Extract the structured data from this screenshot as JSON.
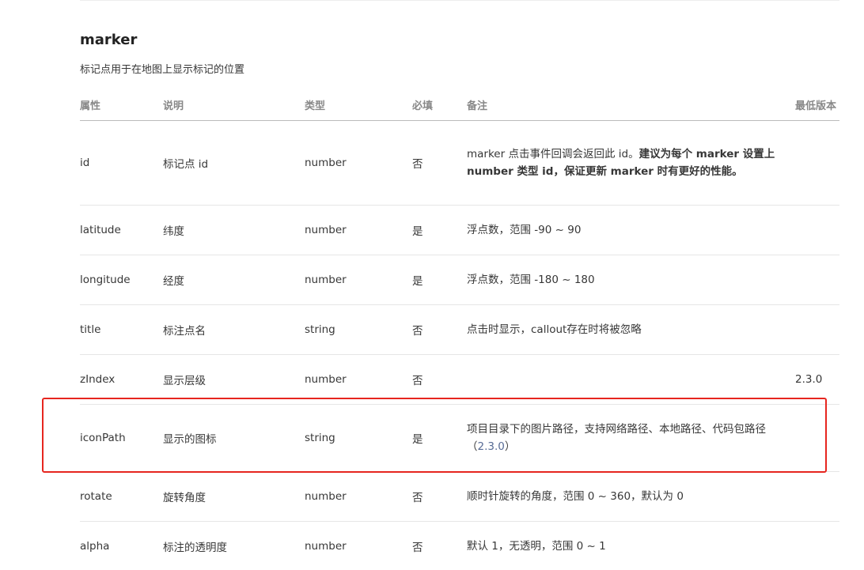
{
  "section": {
    "title": "marker",
    "description": "标记点用于在地图上显示标记的位置"
  },
  "table": {
    "headers": [
      "属性",
      "说明",
      "类型",
      "必填",
      "备注",
      "最低版本"
    ],
    "rows": [
      {
        "attr": "id",
        "desc": "标记点 id",
        "type": "number",
        "required": "否",
        "note_plain": "marker 点击事件回调会返回此 id。",
        "note_bold": "建议为每个 marker 设置上 number 类型 id，保证更新 marker 时有更好的性能。",
        "version": ""
      },
      {
        "attr": "latitude",
        "desc": "纬度",
        "type": "number",
        "required": "是",
        "note_plain": "浮点数，范围 -90 ~ 90",
        "version": ""
      },
      {
        "attr": "longitude",
        "desc": "经度",
        "type": "number",
        "required": "是",
        "note_plain": "浮点数，范围 -180 ~ 180",
        "version": ""
      },
      {
        "attr": "title",
        "desc": "标注点名",
        "type": "string",
        "required": "否",
        "note_plain": "点击时显示，callout存在时将被忽略",
        "version": ""
      },
      {
        "attr": "zIndex",
        "desc": "显示层级",
        "type": "number",
        "required": "否",
        "note_plain": "",
        "version": "2.3.0"
      },
      {
        "attr": "iconPath",
        "desc": "显示的图标",
        "type": "string",
        "required": "是",
        "note_plain": "项目目录下的图片路径，支持网络路径、本地路径、代码包路径（",
        "note_link": "2.3.0",
        "note_suffix": "）",
        "version": ""
      },
      {
        "attr": "rotate",
        "desc": "旋转角度",
        "type": "number",
        "required": "否",
        "note_plain": "顺时针旋转的角度，范围 0 ~ 360，默认为 0",
        "version": ""
      },
      {
        "attr": "alpha",
        "desc": "标注的透明度",
        "type": "number",
        "required": "否",
        "note_plain": "默认 1，无透明，范围 0 ~ 1",
        "version": ""
      }
    ]
  },
  "colors": {
    "highlight_border": "#e6261f",
    "link": "#576b95",
    "header_text": "#888888"
  }
}
